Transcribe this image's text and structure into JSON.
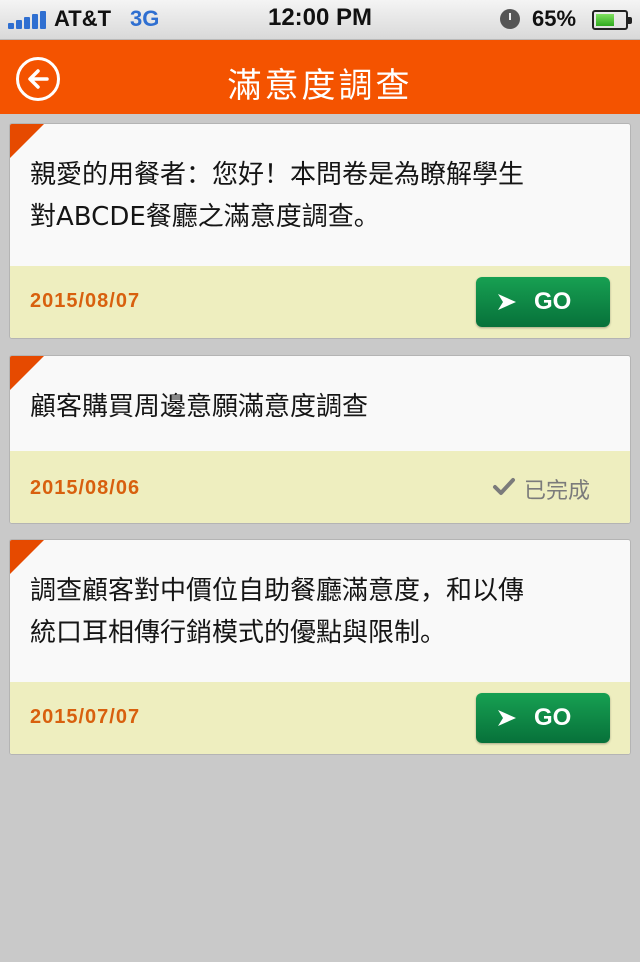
{
  "status_bar": {
    "carrier": "AT&T",
    "network": "3G",
    "time": "12:00 PM",
    "battery": "65%",
    "battery_level": 0.65
  },
  "nav": {
    "title": "滿意度調查",
    "back_icon": "back-arrow-icon"
  },
  "surveys": [
    {
      "text_lines": [
        "親愛的用餐者：您好！本問卷是為瞭解學生",
        "對ABCDE餐廳之滿意度調查。"
      ],
      "date": "2015/08/07",
      "action": "go",
      "go_label": "GO"
    },
    {
      "text_lines": [
        "顧客購買周邊意願滿意度調查"
      ],
      "date": "2015/08/06",
      "action": "done",
      "done_label": "已完成"
    },
    {
      "text_lines": [
        "調查顧客對中價位自助餐廳滿意度，和以傳",
        "統口耳相傳行銷模式的優點與限制。"
      ],
      "date": "2015/07/07",
      "action": "go",
      "go_label": "GO"
    }
  ],
  "colors": {
    "nav_bg": "#f45300",
    "corner": "#e64a00",
    "date": "#d8600e",
    "footer_bg": "#eeeebf",
    "go_button": "#0d8a45",
    "page_bg": "#c9c9c9"
  }
}
